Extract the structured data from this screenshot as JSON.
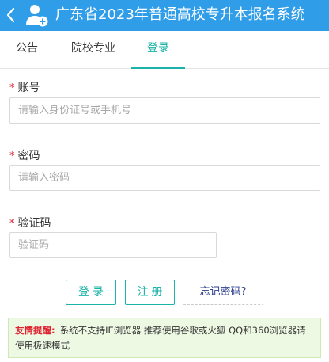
{
  "header": {
    "title": "广东省2023年普通高校专升本报名系统",
    "back_icon": "chevron-left-icon",
    "user_icon": "user-add-icon",
    "background_color": "#2f9de8"
  },
  "tabs": [
    {
      "label": "公告",
      "active": false
    },
    {
      "label": "院校专业",
      "active": false
    },
    {
      "label": "登录",
      "active": true
    }
  ],
  "accent_color": "#1bb3a8",
  "form": {
    "required_mark": "*",
    "account": {
      "label": "账号",
      "placeholder": "请输入身份证号或手机号",
      "value": ""
    },
    "password": {
      "label": "密码",
      "placeholder": "请输入密码",
      "value": ""
    },
    "captcha": {
      "label": "验证码",
      "placeholder": "验证码",
      "value": ""
    }
  },
  "buttons": {
    "login": "登录",
    "register": "注册",
    "forgot": "忘记密码?"
  },
  "notice": {
    "tip_label": "友情提醒:",
    "text": "系统不支持IE浏览器 推荐使用谷歌或火狐 QQ和360浏览器请使用极速模式"
  }
}
